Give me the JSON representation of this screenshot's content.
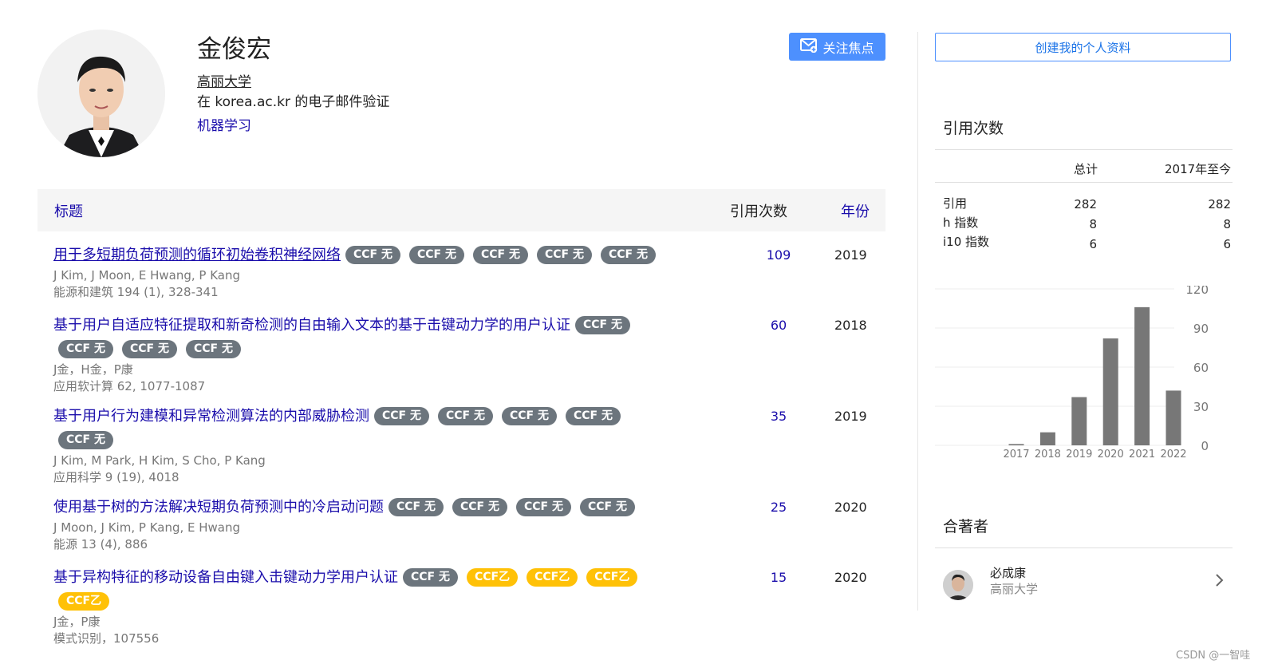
{
  "profile": {
    "name": "金俊宏",
    "affiliation": "高丽大学",
    "email_verified": "在 korea.ac.kr 的电子邮件验证",
    "interest": "机器学习",
    "follow_label": "关注焦点"
  },
  "table": {
    "col_title": "标题",
    "col_cites": "引用次数",
    "col_year": "年份"
  },
  "papers": [
    {
      "title": "用于多短期负荷预测的循环初始卷积神经网络",
      "badges": [
        "CCF 无",
        "CCF 无",
        "CCF 无",
        "CCF 无",
        "CCF 无"
      ],
      "authors": "J Kim, J Moon, E Hwang, P Kang",
      "venue": "能源和建筑 194 (1), 328-341",
      "cites": "109",
      "year": "2019"
    },
    {
      "title": "基于用户自适应特征提取和新奇检测的自由输入文本的基于击键动力学的用户认证",
      "badges": [
        "CCF 无",
        "CCF 无",
        "CCF 无",
        "CCF 无"
      ],
      "authors": "J金，H金，P康",
      "venue": "应用软计算 62, 1077-1087",
      "cites": "60",
      "year": "2018"
    },
    {
      "title": "基于用户行为建模和异常检测算法的内部威胁检测",
      "badges": [
        "CCF 无",
        "CCF 无",
        "CCF 无",
        "CCF 无",
        "CCF 无"
      ],
      "authors": "J Kim, M Park, H Kim, S Cho, P Kang",
      "venue": "应用科学 9 (19), 4018",
      "cites": "35",
      "year": "2019"
    },
    {
      "title": "使用基于树的方法解决短期负荷预测中的冷启动问题",
      "badges": [
        "CCF 无",
        "CCF 无",
        "CCF 无",
        "CCF 无"
      ],
      "authors": "J Moon, J Kim, P Kang, E Hwang",
      "venue": "能源 13 (4), 886",
      "cites": "25",
      "year": "2020"
    },
    {
      "title": "基于异构特征的移动设备自由键入击键动力学用户认证",
      "badges": [
        "CCF 无",
        "CCF乙",
        "CCF乙",
        "CCF乙",
        "CCF乙"
      ],
      "authors": "J金，P康",
      "venue": "模式识别，107556",
      "cites": "15",
      "year": "2020"
    }
  ],
  "sidebar": {
    "create_label": "创建我的个人资料",
    "cited_title": "引用次数",
    "col_total": "总计",
    "col_since": "2017年至今",
    "rows": [
      {
        "label": "引用",
        "total": "282",
        "since": "282"
      },
      {
        "label": "h 指数",
        "total": "8",
        "since": "8"
      },
      {
        "label": "i10 指数",
        "total": "6",
        "since": "6"
      }
    ],
    "coauthors_title": "合著者",
    "coauthor": {
      "name": "必成康",
      "affiliation": "高丽大学"
    }
  },
  "chart_data": {
    "type": "bar",
    "categories": [
      "2017",
      "2018",
      "2019",
      "2020",
      "2021",
      "2022"
    ],
    "values": [
      1,
      10,
      37,
      82,
      106,
      42
    ],
    "ylim": [
      0,
      120
    ],
    "yticks": [
      0,
      30,
      60,
      90,
      120
    ],
    "grid": true,
    "bar_color": "#777777"
  },
  "watermark": "CSDN @一智哇",
  "colors": {
    "link": "#1a0dab",
    "accent": "#4d90fe",
    "badge_gray": "#6c757d",
    "badge_yellow": "#ffc107"
  }
}
